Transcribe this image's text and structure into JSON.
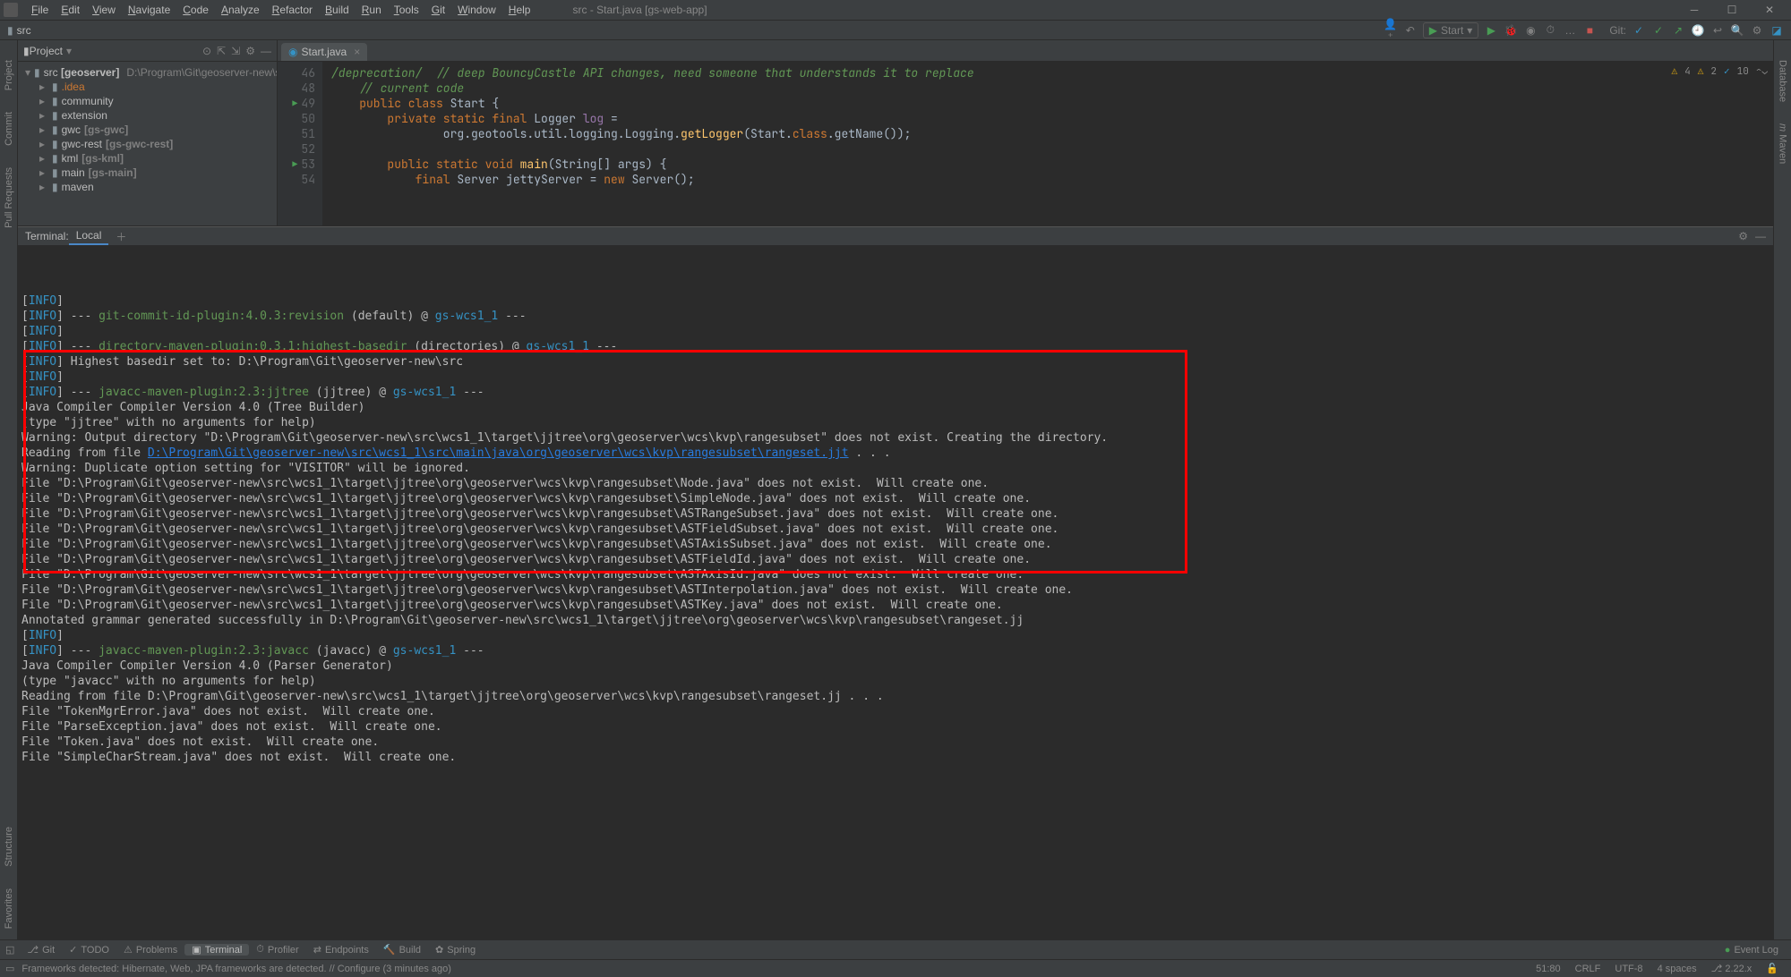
{
  "window": {
    "title": "src - Start.java [gs-web-app]",
    "menus": [
      "File",
      "Edit",
      "View",
      "Navigate",
      "Code",
      "Analyze",
      "Refactor",
      "Build",
      "Run",
      "Tools",
      "Git",
      "Window",
      "Help"
    ]
  },
  "breadcrumb": {
    "label": "src"
  },
  "toolbar": {
    "run_config": "Start",
    "git_label": "Git:"
  },
  "project": {
    "title": "Project",
    "root": {
      "name": "src",
      "bold": "[geoserver]",
      "path": "D:\\Program\\Git\\geoserver-new\\src"
    },
    "items": [
      {
        "label": ".idea",
        "highlight": true
      },
      {
        "label": "community"
      },
      {
        "label": "extension"
      },
      {
        "label": "gwc",
        "sub": "[gs-gwc]"
      },
      {
        "label": "gwc-rest",
        "sub": "[gs-gwc-rest]"
      },
      {
        "label": "kml",
        "sub": "[gs-kml]"
      },
      {
        "label": "main",
        "sub": "[gs-main]"
      },
      {
        "label": "maven"
      }
    ]
  },
  "editor": {
    "tab": "Start.java",
    "warnings_a": "4",
    "warnings_b": "2",
    "info_count": "10",
    "gutter_lines": [
      "46",
      "48",
      "49",
      "50",
      "51",
      "52",
      "53",
      "54"
    ],
    "code_lines": [
      "/deprecation/  // deep BouncyCastle API changes, need someone that understands it to replace",
      "    // current code",
      "    public class Start {",
      "        private static final Logger log =",
      "                org.geotools.util.logging.Logging.getLogger(Start.class.getName());",
      "",
      "        public static void main(String[] args) {",
      "            final Server jettyServer = new Server();"
    ]
  },
  "terminal": {
    "label": "Terminal:",
    "tab": "Local",
    "lines": [
      {
        "t": "info",
        "txt": ""
      },
      {
        "t": "plugin",
        "lead": "--- ",
        "plugin": "git-commit-id-plugin:4.0.3:revision",
        "paren": " (default) @ ",
        "proj": "gs-wcs1_1",
        "trail": " ---"
      },
      {
        "t": "info",
        "txt": ""
      },
      {
        "t": "plugin",
        "lead": "--- ",
        "plugin": "directory-maven-plugin:0.3.1:highest-basedir",
        "paren": " (directories) @ ",
        "proj": "gs-wcs1_1",
        "trail": " ---"
      },
      {
        "t": "plain",
        "txt": "Highest basedir set to: D:\\Program\\Git\\geoserver-new\\src"
      },
      {
        "t": "info",
        "txt": ""
      },
      {
        "t": "plugin",
        "lead": "--- ",
        "plugin": "javacc-maven-plugin:2.3:jjtree",
        "paren": " (jjtree) @ ",
        "proj": "gs-wcs1_1",
        "trail": " ---"
      },
      {
        "t": "raw",
        "txt": "Java Compiler Compiler Version 4.0 (Tree Builder)"
      },
      {
        "t": "raw",
        "txt": "(type \"jjtree\" with no arguments for help)"
      },
      {
        "t": "raw",
        "txt": "Warning: Output directory \"D:\\Program\\Git\\geoserver-new\\src\\wcs1_1\\target\\jjtree\\org\\geoserver\\wcs\\kvp\\rangesubset\" does not exist. Creating the directory."
      },
      {
        "t": "link",
        "pre": "Reading from file ",
        "link": "D:\\Program\\Git\\geoserver-new\\src\\wcs1_1\\src\\main\\java\\org\\geoserver\\wcs\\kvp\\rangesubset\\rangeset.jjt",
        "post": " . . ."
      },
      {
        "t": "raw",
        "txt": "Warning: Duplicate option setting for \"VISITOR\" will be ignored."
      },
      {
        "t": "raw",
        "txt": "File \"D:\\Program\\Git\\geoserver-new\\src\\wcs1_1\\target\\jjtree\\org\\geoserver\\wcs\\kvp\\rangesubset\\Node.java\" does not exist.  Will create one."
      },
      {
        "t": "raw",
        "txt": "File \"D:\\Program\\Git\\geoserver-new\\src\\wcs1_1\\target\\jjtree\\org\\geoserver\\wcs\\kvp\\rangesubset\\SimpleNode.java\" does not exist.  Will create one."
      },
      {
        "t": "raw",
        "txt": "File \"D:\\Program\\Git\\geoserver-new\\src\\wcs1_1\\target\\jjtree\\org\\geoserver\\wcs\\kvp\\rangesubset\\ASTRangeSubset.java\" does not exist.  Will create one."
      },
      {
        "t": "raw",
        "txt": "File \"D:\\Program\\Git\\geoserver-new\\src\\wcs1_1\\target\\jjtree\\org\\geoserver\\wcs\\kvp\\rangesubset\\ASTFieldSubset.java\" does not exist.  Will create one."
      },
      {
        "t": "raw",
        "txt": "File \"D:\\Program\\Git\\geoserver-new\\src\\wcs1_1\\target\\jjtree\\org\\geoserver\\wcs\\kvp\\rangesubset\\ASTAxisSubset.java\" does not exist.  Will create one."
      },
      {
        "t": "raw",
        "txt": "File \"D:\\Program\\Git\\geoserver-new\\src\\wcs1_1\\target\\jjtree\\org\\geoserver\\wcs\\kvp\\rangesubset\\ASTFieldId.java\" does not exist.  Will create one."
      },
      {
        "t": "raw",
        "txt": "File \"D:\\Program\\Git\\geoserver-new\\src\\wcs1_1\\target\\jjtree\\org\\geoserver\\wcs\\kvp\\rangesubset\\ASTAxisId.java\" does not exist.  Will create one."
      },
      {
        "t": "raw",
        "txt": "File \"D:\\Program\\Git\\geoserver-new\\src\\wcs1_1\\target\\jjtree\\org\\geoserver\\wcs\\kvp\\rangesubset\\ASTInterpolation.java\" does not exist.  Will create one."
      },
      {
        "t": "raw",
        "txt": "File \"D:\\Program\\Git\\geoserver-new\\src\\wcs1_1\\target\\jjtree\\org\\geoserver\\wcs\\kvp\\rangesubset\\ASTKey.java\" does not exist.  Will create one."
      },
      {
        "t": "raw",
        "txt": "Annotated grammar generated successfully in D:\\Program\\Git\\geoserver-new\\src\\wcs1_1\\target\\jjtree\\org\\geoserver\\wcs\\kvp\\rangesubset\\rangeset.jj"
      },
      {
        "t": "info",
        "txt": ""
      },
      {
        "t": "plugin",
        "lead": "--- ",
        "plugin": "javacc-maven-plugin:2.3:javacc",
        "paren": " (javacc) @ ",
        "proj": "gs-wcs1_1",
        "trail": " ---"
      },
      {
        "t": "raw",
        "txt": "Java Compiler Compiler Version 4.0 (Parser Generator)"
      },
      {
        "t": "raw",
        "txt": "(type \"javacc\" with no arguments for help)"
      },
      {
        "t": "raw",
        "txt": "Reading from file D:\\Program\\Git\\geoserver-new\\src\\wcs1_1\\target\\jjtree\\org\\geoserver\\wcs\\kvp\\rangesubset\\rangeset.jj . . ."
      },
      {
        "t": "raw",
        "txt": "File \"TokenMgrError.java\" does not exist.  Will create one."
      },
      {
        "t": "raw",
        "txt": "File \"ParseException.java\" does not exist.  Will create one."
      },
      {
        "t": "raw",
        "txt": "File \"Token.java\" does not exist.  Will create one."
      },
      {
        "t": "raw",
        "txt": "File \"SimpleCharStream.java\" does not exist.  Will create one."
      }
    ]
  },
  "bottom_tabs": [
    "Git",
    "TODO",
    "Problems",
    "Terminal",
    "Profiler",
    "Endpoints",
    "Build",
    "Spring"
  ],
  "event_log": "Event Log",
  "status": {
    "msg": "Frameworks detected: Hibernate, Web, JPA frameworks are detected. // Configure (3 minutes ago)",
    "pos": "51:80",
    "sep": "CRLF",
    "enc": "UTF-8",
    "indent": "4 spaces",
    "branch": "2.22.x"
  }
}
